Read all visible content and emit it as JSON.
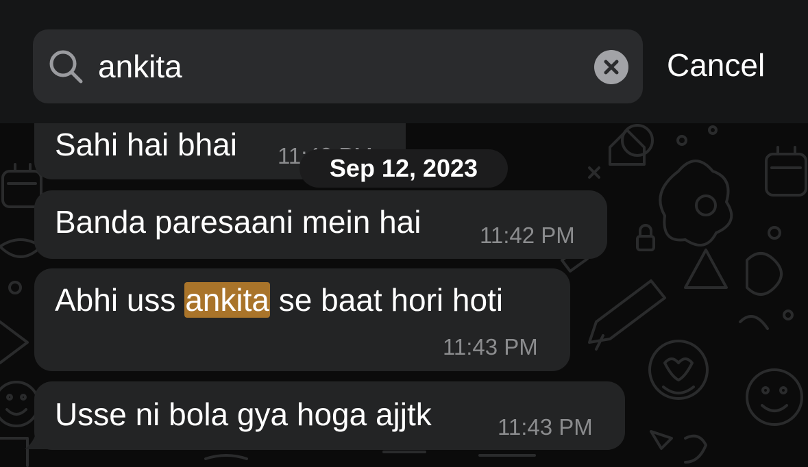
{
  "search": {
    "query": "ankita",
    "cancel_label": "Cancel"
  },
  "date_separator": "Sep 12, 2023",
  "messages": [
    {
      "text": "Sahi hai bhai",
      "time": "11:40 PM"
    },
    {
      "text": "Banda paresaani mein hai",
      "time": "11:42 PM"
    },
    {
      "text_before": "Abhi uss ",
      "highlight": "ankita",
      "text_after": " se baat hori hoti",
      "time": "11:43 PM"
    },
    {
      "text": "Usse ni bola gya hoga ajjtk",
      "time": "11:43 PM"
    }
  ],
  "colors": {
    "bubble": "#232425",
    "highlight": "#a9742a",
    "background": "#0b0b0b",
    "timestamp": "#8b8c8e"
  },
  "icons": [
    "search-icon",
    "clear-icon",
    "chat-wallpaper-doodles"
  ]
}
